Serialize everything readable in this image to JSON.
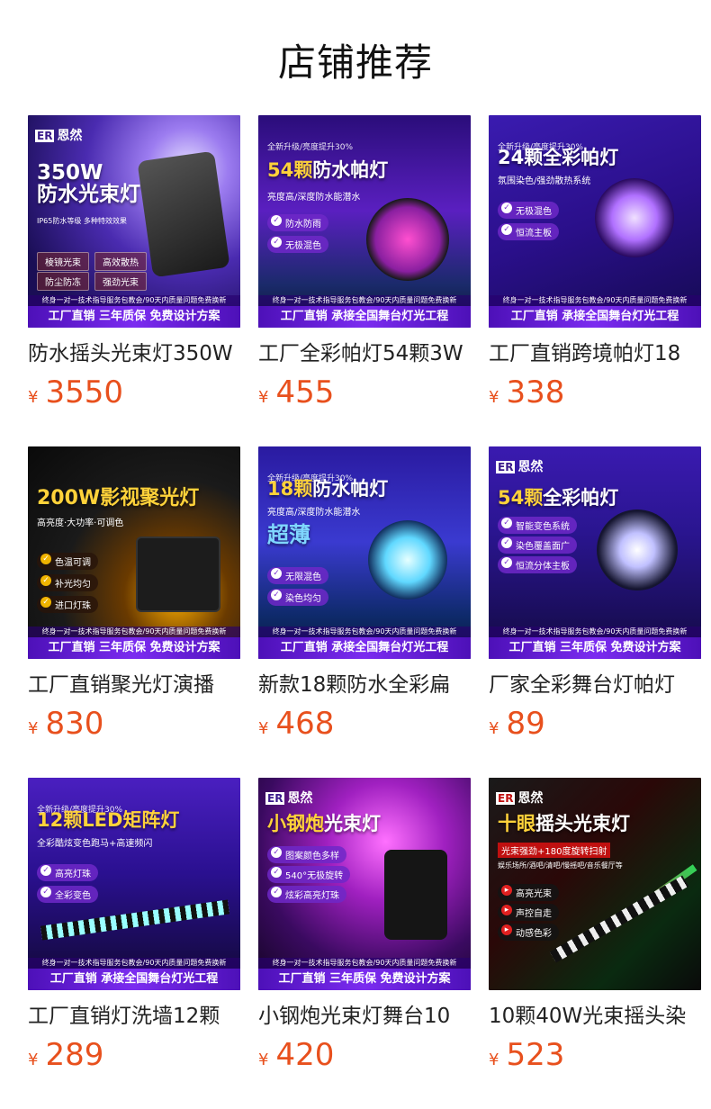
{
  "header": {
    "title": "店铺推荐"
  },
  "products": [
    {
      "brand": "恩然",
      "headline_a": "350W",
      "headline_b": "防水光束灯",
      "sub": "IP65防水等级  多种特效效果",
      "chips": [
        "棱镜光束",
        "高效散热",
        "防尘防冻",
        "强劲光束"
      ],
      "service": "终身一对一技术指导服务包教会/90天内质量问题免费换新",
      "banner": "工厂直销 三年质保 免费设计方案",
      "name": "防水摇头光束灯350W",
      "currency": "¥",
      "price": "3550"
    },
    {
      "promo": "全新升级/亮度提升30%",
      "headline_a": "54颗",
      "headline_b": "防水帕灯",
      "sub": "亮度高/深度防水能潜水",
      "chips": [
        "防水防雨",
        "无极混色"
      ],
      "service": "终身一对一技术指导服务包教会/90天内质量问题免费换新",
      "banner": "工厂直销 承接全国舞台灯光工程",
      "name": "工厂全彩帕灯54颗3W",
      "currency": "¥",
      "price": "455"
    },
    {
      "promo": "全新升级/亮度提升30%",
      "headline_a": "24颗",
      "headline_b": "全彩帕灯",
      "sub": "氛围染色/强劲散热系统",
      "chips": [
        "无极混色",
        "恒流主板"
      ],
      "service": "终身一对一技术指导服务包教会/90天内质量问题免费换新",
      "banner": "工厂直销 承接全国舞台灯光工程",
      "name": "工厂直销跨境帕灯18",
      "currency": "¥",
      "price": "338"
    },
    {
      "headline_a": "200W",
      "headline_b": "影视聚光灯",
      "sub": "高亮度·大功率·可调色",
      "chips": [
        "色温可调",
        "补光均匀",
        "进口灯珠"
      ],
      "service": "终身一对一技术指导服务包教会/90天内质量问题免费换新",
      "banner": "工厂直销 三年质保 免费设计方案",
      "name": "工厂直销聚光灯演播",
      "currency": "¥",
      "price": "830"
    },
    {
      "promo": "全新升级/亮度提升30%",
      "headline_a": "18颗",
      "headline_b": "防水帕灯",
      "sub": "亮度高/深度防水能潜水",
      "extra": "超薄",
      "chips": [
        "无限混色",
        "染色均匀"
      ],
      "service": "终身一对一技术指导服务包教会/90天内质量问题免费换新",
      "banner": "工厂直销 承接全国舞台灯光工程",
      "name": "新款18颗防水全彩扁",
      "currency": "¥",
      "price": "468"
    },
    {
      "brand": "恩然",
      "headline_a": "54颗",
      "headline_b": "全彩帕灯",
      "chips": [
        "智能变色系统",
        "染色覆盖面广",
        "恒流分体主板"
      ],
      "service": "终身一对一技术指导服务包教会/90天内质量问题免费换新",
      "banner": "工厂直销 三年质保 免费设计方案",
      "name": "厂家全彩舞台灯帕灯",
      "currency": "¥",
      "price": "89"
    },
    {
      "promo": "全新升级/亮度提升30%",
      "headline_a": "12颗",
      "headline_b": "LED矩阵灯",
      "sub": "全彩酷炫变色跑马+高速频闪",
      "chips": [
        "高亮灯珠",
        "全彩变色"
      ],
      "service": "终身一对一技术指导服务包教会/90天内质量问题免费换新",
      "banner": "工厂直销 承接全国舞台灯光工程",
      "name": "工厂直销灯洗墙12颗",
      "currency": "¥",
      "price": "289"
    },
    {
      "brand": "恩然",
      "headline_a": "小钢炮",
      "headline_b": "光束灯",
      "chips": [
        "图案颜色多样",
        "540°无极旋转",
        "炫彩高亮灯珠"
      ],
      "service": "终身一对一技术指导服务包教会/90天内质量问题免费换新",
      "banner": "工厂直销 三年质保 免费设计方案",
      "name": "小钢炮光束灯舞台10",
      "currency": "¥",
      "price": "420"
    },
    {
      "brand": "恩然",
      "headline_a": "十眼",
      "headline_b": "摇头光束灯",
      "sub": "光束强劲+180度旋转扫射",
      "sub2": "娱乐场所/酒吧/清吧/慢摇吧/音乐餐厅等",
      "chips": [
        "高亮光束",
        "声控自走",
        "动感色彩"
      ],
      "name": "10颗40W光束摇头染",
      "currency": "¥",
      "price": "523"
    }
  ]
}
